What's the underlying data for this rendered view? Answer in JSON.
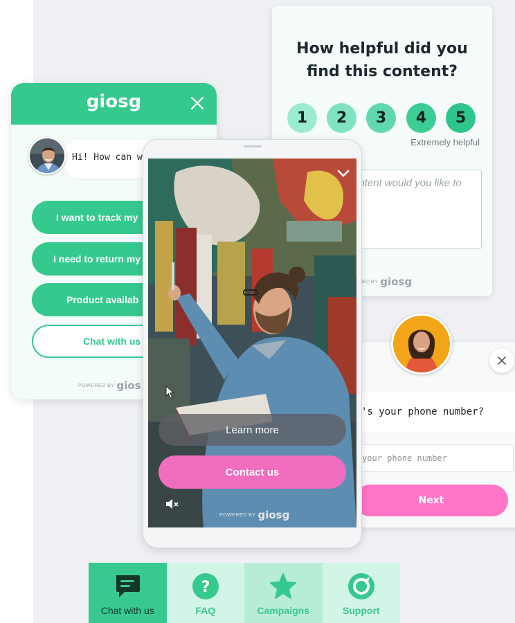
{
  "feedback": {
    "question": "How helpful did you find this content?",
    "ratings": [
      "1",
      "2",
      "3",
      "4",
      "5"
    ],
    "scale_max_label": "Extremely helpful",
    "textarea_placeholder": "ontent would you like to",
    "powered_prefix": "ERED BY",
    "powered_brand": "giosg"
  },
  "chat": {
    "logo": "giosg",
    "greeting": "Hi! How can we",
    "options": [
      "I want to track my",
      "I need to return my",
      "Product availab",
      "Chat with us"
    ],
    "powered_prefix": "POWERED BY",
    "powered_brand": "gios"
  },
  "phone_video": {
    "learn_more": "Learn more",
    "contact_us": "Contact us",
    "powered_prefix": "POWERED BY",
    "powered_brand": "giosg"
  },
  "phone_form": {
    "question": "'s your phone number?",
    "input_placeholder": "your phone number",
    "next": "Next"
  },
  "nav": {
    "items": [
      "Chat with us",
      "FAQ",
      "Campaigns",
      "Support"
    ]
  },
  "colors": {
    "brand_green": "#35c98e",
    "pink": "#f06dc0",
    "dark_text": "#1b2a2f"
  }
}
